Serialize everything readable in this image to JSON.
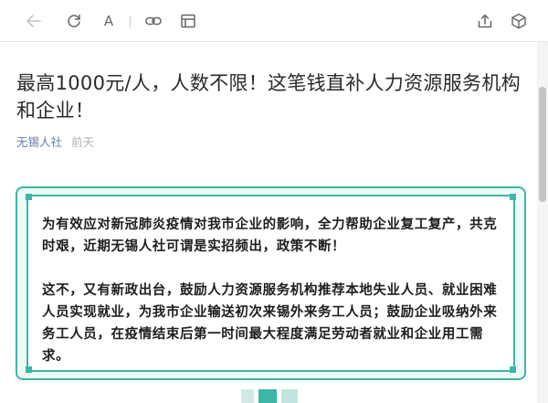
{
  "toolbar": {
    "icons": [
      "back-arrow-icon",
      "refresh-icon",
      "font-size-icon",
      "link-icon",
      "browser-icon",
      "share-icon",
      "cube-icon"
    ],
    "font_label": "A"
  },
  "article": {
    "title": "最高1000元/人，人数不限！这笔钱直补人力资源服务机构和企业！",
    "source": "无锡人社",
    "time": "前天",
    "paragraphs": [
      "为有效应对新冠肺炎疫情对我市企业的影响，全力帮助企业复工复产，共克时艰，近期无锡人社可谓是实招频出，政策不断！",
      "这不，又有新政出台，鼓励人力资源服务机构推荐本地失业人员、就业困难人员实现就业，为我市企业输送初次来锡外来务工人员；鼓励企业吸纳外来务工人员，在疫情结束后第一时间最大程度满足劳动者就业和企业用工需求。"
    ]
  },
  "colors": {
    "accent": "#3bb7a6",
    "source_link": "#607fa6",
    "time_gray": "#b2b2b2"
  }
}
